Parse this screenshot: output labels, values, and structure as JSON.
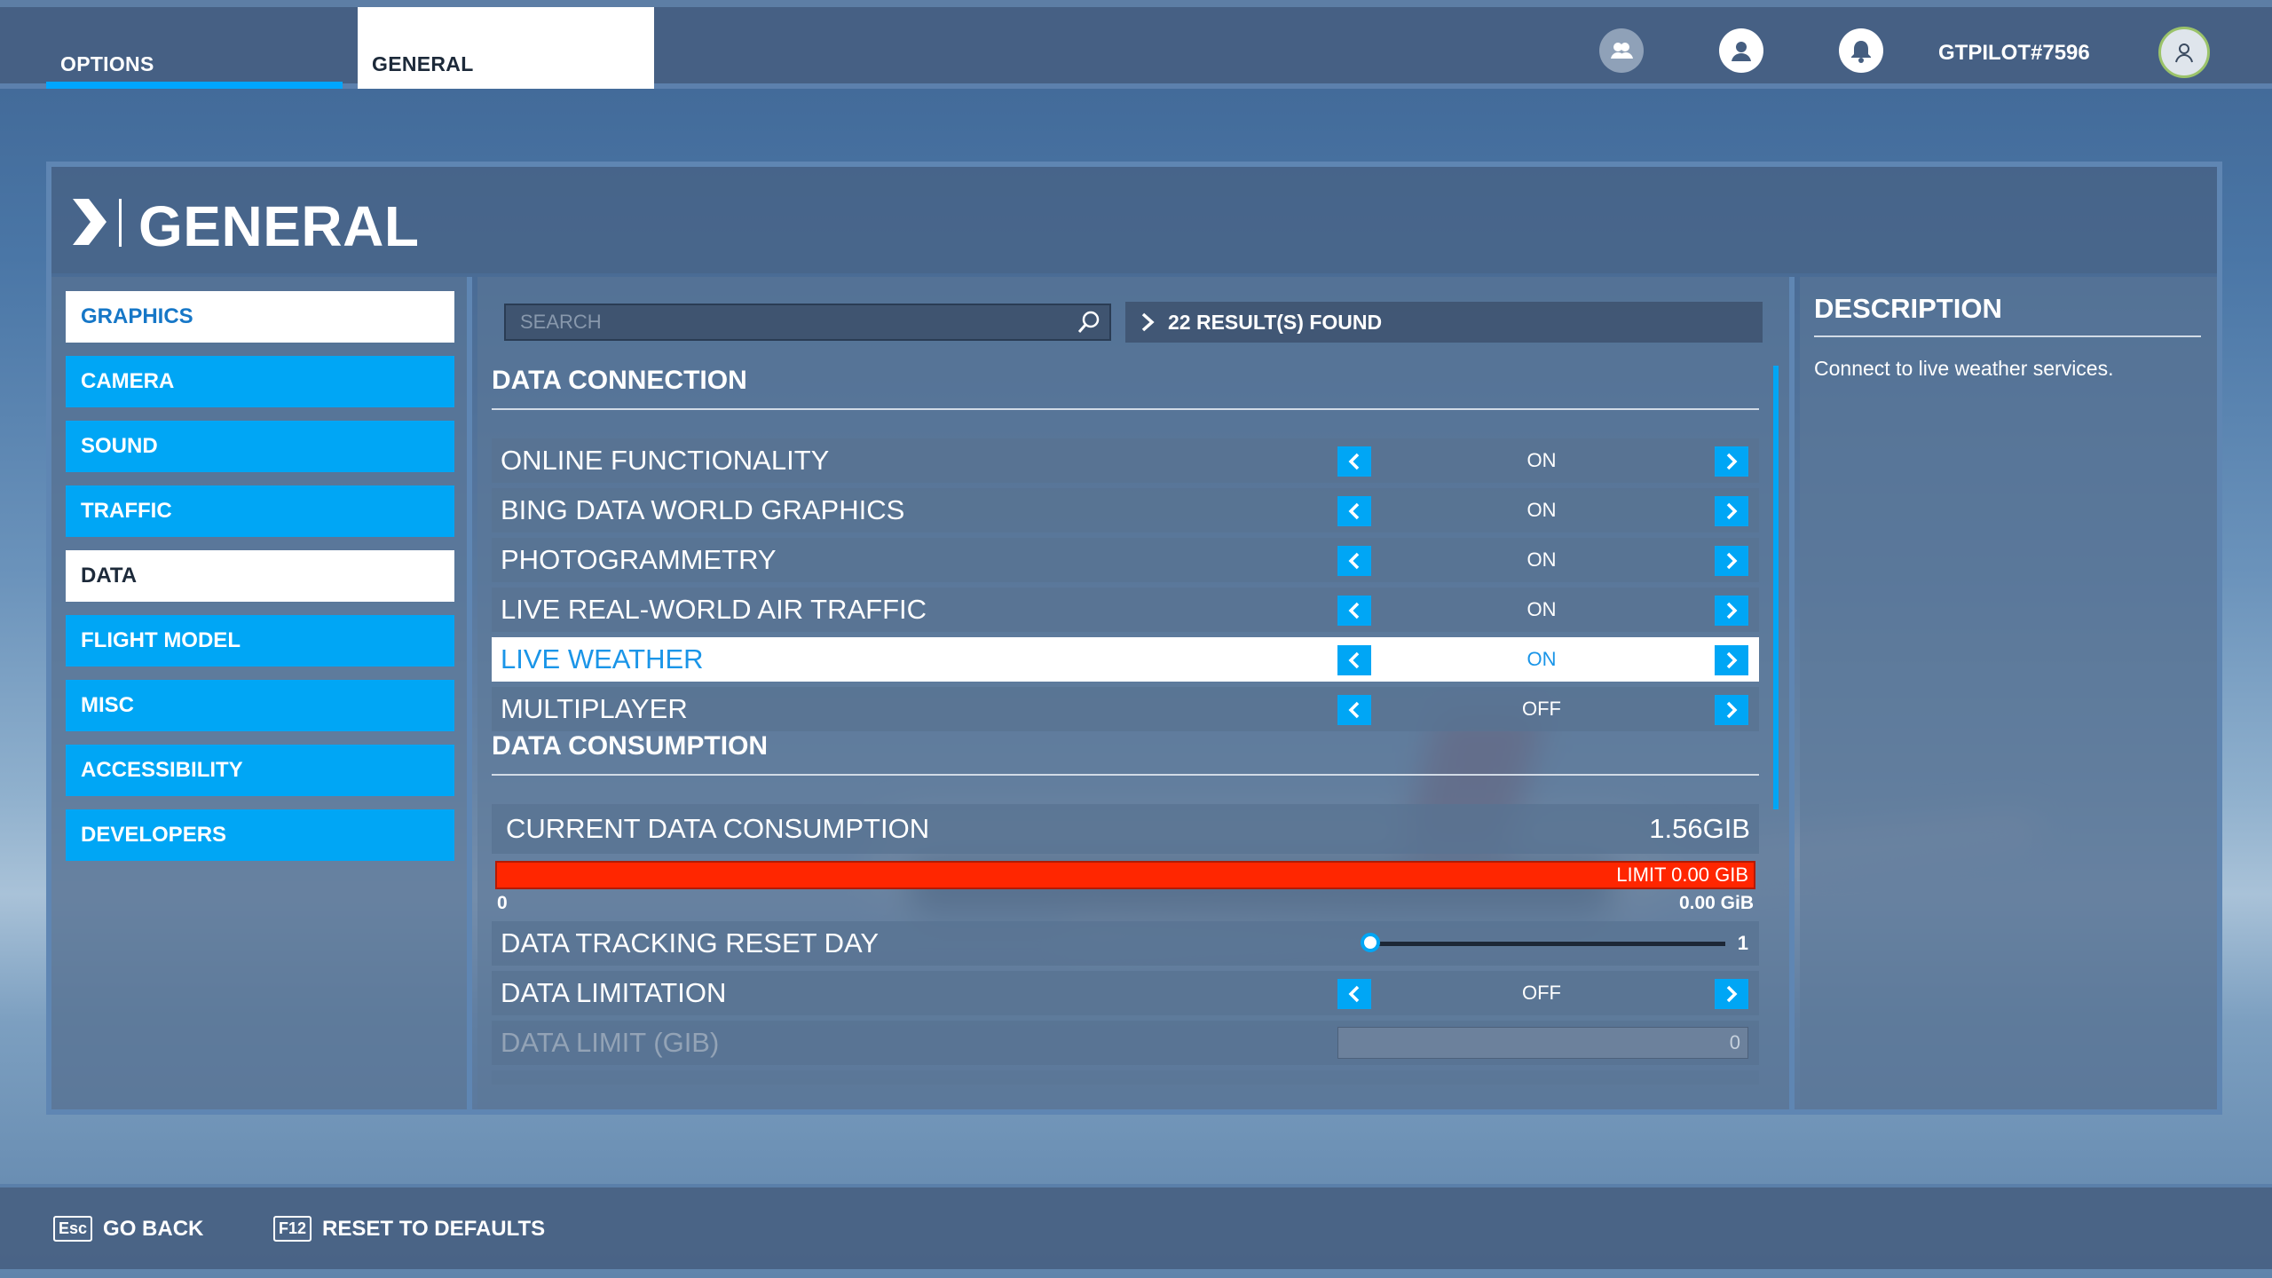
{
  "topbar": {
    "tabs": [
      {
        "label": "OPTIONS"
      },
      {
        "label": "GENERAL"
      }
    ],
    "username": "GTPILOT#7596",
    "icons": [
      "friends-icon",
      "profile-icon",
      "notification-bell-icon",
      "avatar-icon"
    ]
  },
  "page": {
    "title": "GENERAL"
  },
  "menu": {
    "items": [
      {
        "label": "GRAPHICS",
        "state": "active"
      },
      {
        "label": "CAMERA",
        "state": "normal"
      },
      {
        "label": "SOUND",
        "state": "normal"
      },
      {
        "label": "TRAFFIC",
        "state": "normal"
      },
      {
        "label": "DATA",
        "state": "selected"
      },
      {
        "label": "FLIGHT MODEL",
        "state": "normal"
      },
      {
        "label": "MISC",
        "state": "normal"
      },
      {
        "label": "ACCESSIBILITY",
        "state": "normal"
      },
      {
        "label": "DEVELOPERS",
        "state": "normal"
      }
    ]
  },
  "search": {
    "placeholder": "SEARCH",
    "results": "22 RESULT(S) FOUND"
  },
  "data_connection": {
    "title": "DATA CONNECTION",
    "rows": [
      {
        "label": "ONLINE FUNCTIONALITY",
        "value": "ON"
      },
      {
        "label": "BING DATA WORLD GRAPHICS",
        "value": "ON"
      },
      {
        "label": "PHOTOGRAMMETRY",
        "value": "ON"
      },
      {
        "label": "LIVE REAL-WORLD AIR TRAFFIC",
        "value": "ON"
      },
      {
        "label": "LIVE WEATHER",
        "value": "ON"
      },
      {
        "label": "MULTIPLAYER",
        "value": "OFF"
      }
    ]
  },
  "data_consumption": {
    "title": "DATA CONSUMPTION",
    "current_label": "CURRENT DATA CONSUMPTION",
    "current_value": "1.56GIB",
    "limit_bar_label": "LIMIT 0.00 GIB",
    "bar_min": "0",
    "bar_max": "0.00 GiB",
    "reset_day_label": "DATA TRACKING RESET DAY",
    "reset_day_value": "1",
    "reset_day_min": 1,
    "reset_day_max": 31,
    "limitation_label": "DATA LIMITATION",
    "limitation_value": "OFF",
    "limit_label": "DATA LIMIT (GIB)",
    "limit_value": "0"
  },
  "description": {
    "title": "DESCRIPTION",
    "text": "Connect to live weather services."
  },
  "bottombar": {
    "back_key": "Esc",
    "back_label": "GO BACK",
    "reset_key": "F12",
    "reset_label": "RESET TO DEFAULTS"
  },
  "colors": {
    "accent": "#00a6f5",
    "limit_bar": "#ff2600",
    "highlight_text": "#1a95e8"
  }
}
